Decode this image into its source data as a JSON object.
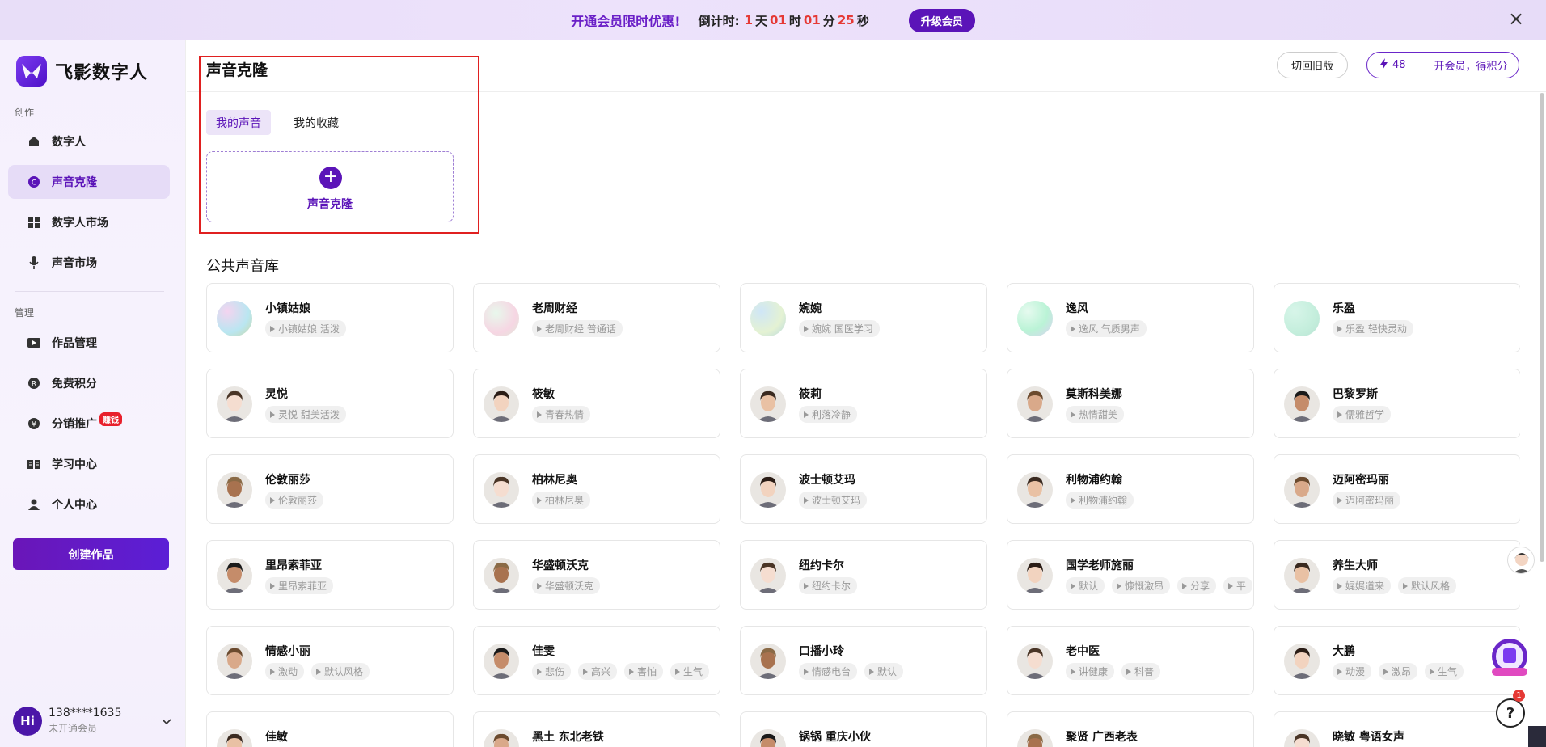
{
  "banner": {
    "promo": "开通会员限时优惠!",
    "countdown_label": "倒计时:",
    "days": "1",
    "days_unit": "天",
    "hours": "01",
    "hours_unit": "时",
    "minutes": "01",
    "minutes_unit": "分",
    "seconds": "25",
    "seconds_unit": "秒",
    "upgrade": "升级会员"
  },
  "brand": {
    "name": "飞影数字人"
  },
  "sidebar": {
    "section_create": "创作",
    "section_manage": "管理",
    "items": [
      {
        "label": "数字人",
        "icon": "home-icon"
      },
      {
        "label": "声音克隆",
        "icon": "copyright-icon"
      },
      {
        "label": "数字人市场",
        "icon": "grid-icon"
      },
      {
        "label": "声音市场",
        "icon": "mic-icon"
      },
      {
        "label": "作品管理",
        "icon": "video-icon"
      },
      {
        "label": "免费积分",
        "icon": "r-coin-icon"
      },
      {
        "label": "分销推广",
        "icon": "yen-icon"
      },
      {
        "label": "学习中心",
        "icon": "book-icon"
      },
      {
        "label": "个人中心",
        "icon": "person-icon"
      }
    ],
    "earn_badge": "赚钱",
    "create_button": "创建作品"
  },
  "user": {
    "avatar": "Hi",
    "phone": "138****1635",
    "tier": "未开通会员"
  },
  "header": {
    "old_version": "切回旧版",
    "points": "48",
    "points_cta": "开会员，得积分"
  },
  "clone": {
    "title": "声音克隆",
    "tabs": [
      "我的声音",
      "我的收藏"
    ],
    "card_label": "声音克隆"
  },
  "library": {
    "title": "公共声音库",
    "voices": [
      {
        "name": "小镇姑娘",
        "tags": [
          "小镇姑娘 活泼"
        ]
      },
      {
        "name": "老周财经",
        "tags": [
          "老周财经 普通话"
        ]
      },
      {
        "name": "婉婉",
        "tags": [
          "婉婉 国医学习"
        ]
      },
      {
        "name": "逸风",
        "tags": [
          "逸风 气质男声"
        ]
      },
      {
        "name": "乐盈",
        "tags": [
          "乐盈 轻快灵动"
        ]
      },
      {
        "name": "灵悦",
        "tags": [
          "灵悦 甜美活泼"
        ]
      },
      {
        "name": "筱敏",
        "tags": [
          "青春热情"
        ]
      },
      {
        "name": "筱莉",
        "tags": [
          "利落冷静"
        ]
      },
      {
        "name": "莫斯科美娜",
        "tags": [
          "热情甜美"
        ]
      },
      {
        "name": "巴黎罗斯",
        "tags": [
          "儒雅哲学"
        ]
      },
      {
        "name": "伦敦丽莎",
        "tags": [
          "伦敦丽莎"
        ]
      },
      {
        "name": "柏林尼奥",
        "tags": [
          "柏林尼奥"
        ]
      },
      {
        "name": "波士顿艾玛",
        "tags": [
          "波士顿艾玛"
        ]
      },
      {
        "name": "利物浦约翰",
        "tags": [
          "利物浦约翰"
        ]
      },
      {
        "name": "迈阿密玛丽",
        "tags": [
          "迈阿密玛丽"
        ]
      },
      {
        "name": "里昂索菲亚",
        "tags": [
          "里昂索菲亚"
        ]
      },
      {
        "name": "华盛顿沃克",
        "tags": [
          "华盛顿沃克"
        ]
      },
      {
        "name": "纽约卡尔",
        "tags": [
          "纽约卡尔"
        ]
      },
      {
        "name": "国学老师施丽",
        "tags": [
          "默认",
          "慷慨激昂",
          "分享",
          "平"
        ]
      },
      {
        "name": "养生大师",
        "tags": [
          "娓娓道来",
          "默认风格"
        ]
      },
      {
        "name": "情感小丽",
        "tags": [
          "激动",
          "默认风格"
        ]
      },
      {
        "name": "佳雯",
        "tags": [
          "悲伤",
          "高兴",
          "害怕",
          "生气"
        ]
      },
      {
        "name": "口播小玲",
        "tags": [
          "情感电台",
          "默认"
        ]
      },
      {
        "name": "老中医",
        "tags": [
          "讲健康",
          "科普"
        ]
      },
      {
        "name": "大鹏",
        "tags": [
          "动漫",
          "激昂",
          "生气"
        ]
      },
      {
        "name": "佳敏",
        "tags": []
      },
      {
        "name": "黑土 东北老铁",
        "tags": []
      },
      {
        "name": "锅锅 重庆小伙",
        "tags": []
      },
      {
        "name": "聚贤 广西老表",
        "tags": []
      },
      {
        "name": "晓敏 粤语女声",
        "tags": []
      }
    ]
  },
  "help": {
    "symbol": "?",
    "count": "1"
  }
}
